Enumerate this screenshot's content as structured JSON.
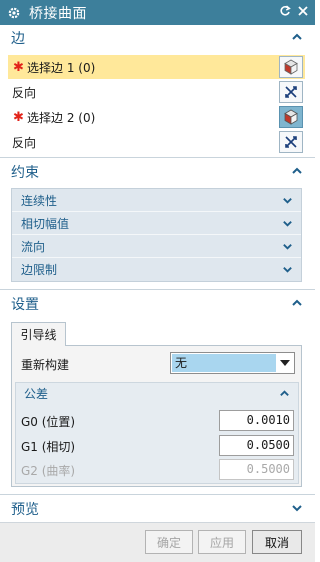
{
  "window": {
    "title": "桥接曲面",
    "reset_icon": "reset-icon",
    "close_icon": "close-icon"
  },
  "edges": {
    "header": "边",
    "select_edge_1": "选择边 1 (0)",
    "reverse_1": "反向",
    "select_edge_2": "选择边 2 (0)",
    "reverse_2": "反向",
    "required_mark": "✱"
  },
  "constraints": {
    "header": "约束",
    "items": [
      {
        "label": "连续性"
      },
      {
        "label": "相切幅值"
      },
      {
        "label": "流向"
      },
      {
        "label": "边限制"
      }
    ]
  },
  "settings": {
    "header": "设置",
    "tab_label": "引导线",
    "rebuild_label": "重新构建",
    "rebuild_value": "无",
    "tolerance": {
      "header": "公差",
      "rows": [
        {
          "label": "G0 (位置)",
          "value": "0.0010",
          "enabled": true
        },
        {
          "label": "G1 (相切)",
          "value": "0.0500",
          "enabled": true
        },
        {
          "label": "G2 (曲率)",
          "value": "0.5000",
          "enabled": false
        }
      ]
    }
  },
  "preview": {
    "header": "预览"
  },
  "buttons": {
    "ok": "确定",
    "apply": "应用",
    "cancel": "取消"
  },
  "colors": {
    "titlebar": "#3d7f9b",
    "section_text": "#1f5f8b",
    "selected_row": "#ffe89a",
    "required_star": "#e2231a"
  }
}
